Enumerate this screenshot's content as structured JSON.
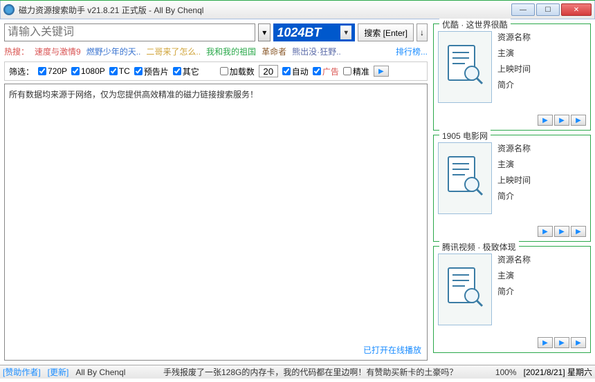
{
  "window": {
    "title": "磁力资源搜索助手 v21.8.21 正式版 - All By Chenql"
  },
  "search": {
    "placeholder": "请输入关键词",
    "source": "1024BT",
    "button": "搜索 [Enter]",
    "down_arrow": "↓"
  },
  "hot": {
    "label": "热搜：",
    "items": [
      {
        "text": "速度与激情9",
        "color": "#d95454"
      },
      {
        "text": "燃野少年的天..",
        "color": "#3a74d0"
      },
      {
        "text": "二哥来了怎么..",
        "color": "#d0a43a"
      },
      {
        "text": "我和我的祖国",
        "color": "#2aa84a"
      },
      {
        "text": "革命者",
        "color": "#8b5a2b"
      },
      {
        "text": "熊出没·狂野..",
        "color": "#5a6aa8"
      }
    ],
    "rank": "排行榜..."
  },
  "filters": {
    "label": "筛选：",
    "p720": "720P",
    "p1080": "1080P",
    "tc": "TC",
    "trailer": "预告片",
    "other": "其它",
    "load_label": "加载数",
    "load_count": "20",
    "auto": "自动",
    "ads": "广告",
    "precise": "精准"
  },
  "results": {
    "notice": "所有数据均来源于网络，仅为您提供高效精准的磁力链接搜索服务！",
    "online_play": "已打开在线播放"
  },
  "cards": [
    {
      "title": "优酷 · 这世界很酷",
      "name": "资源名称",
      "actor": "主演",
      "date": "上映时间",
      "intro": "简介"
    },
    {
      "title": "1905 电影网",
      "name": "资源名称",
      "actor": "主演",
      "date": "上映时间",
      "intro": "简介"
    },
    {
      "title": "腾讯视频 · 极致体现",
      "name": "资源名称",
      "actor": "主演",
      "date": "",
      "intro": "简介"
    }
  ],
  "status": {
    "sponsor": "[赞助作者]",
    "update": "[更新]",
    "author": "All By Chenql",
    "msg": "手残报废了一张128G的内存卡，我的代码都在里边啊！有赞助买新卡的土豪吗？",
    "pct": "100%",
    "date": "[2021/8/21] 星期六"
  }
}
